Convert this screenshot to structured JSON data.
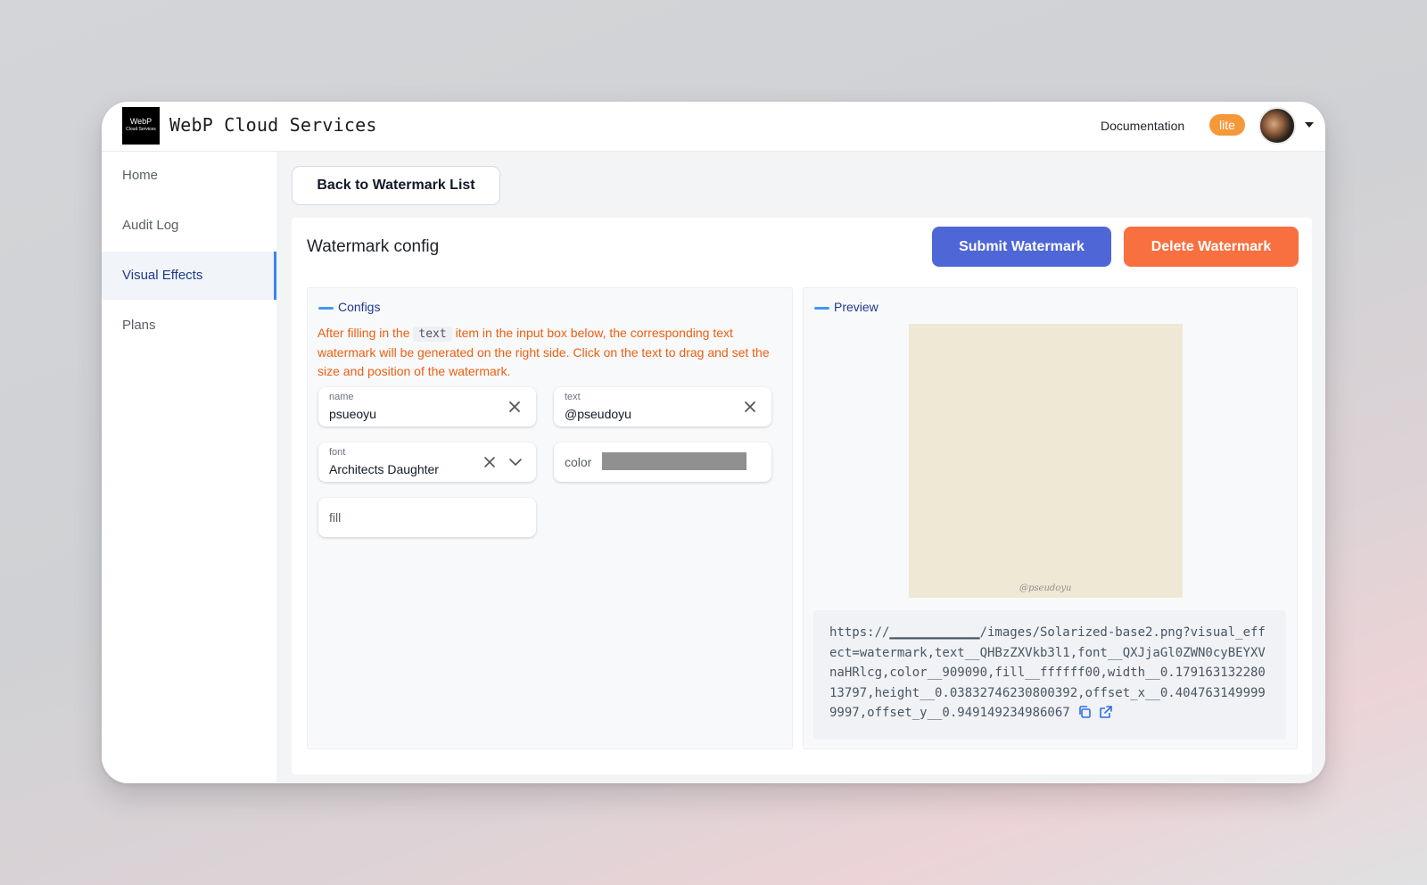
{
  "header": {
    "logo_line1": "WebP",
    "logo_line2": "Cloud Services",
    "title": "WebP Cloud Services",
    "documentation_label": "Documentation",
    "plan_badge": "lite"
  },
  "sidebar": {
    "items": [
      {
        "label": "Home"
      },
      {
        "label": "Audit Log"
      },
      {
        "label": "Visual Effects",
        "active": true
      },
      {
        "label": "Plans"
      }
    ]
  },
  "main": {
    "back_button_label": "Back to Watermark List",
    "card_title": "Watermark config",
    "submit_label": "Submit Watermark",
    "delete_label": "Delete Watermark"
  },
  "configs": {
    "section_label": "Configs",
    "hint_before": "After filling in the ",
    "hint_code": "text",
    "hint_after": " item in the input box below, the corresponding text watermark will be generated on the right side. Click on the text to drag and set the size and position of the watermark.",
    "name_label": "name",
    "name_value": "psueoyu",
    "text_label": "text",
    "text_value": "@pseudoyu",
    "font_label": "font",
    "font_value": "Architects Daughter",
    "color_label": "color",
    "color_value": "#909090",
    "fill_placeholder": "fill"
  },
  "preview": {
    "section_label": "Preview",
    "background_color": "#eee8d5",
    "watermark_text": "@pseudoyu",
    "url": "https://▁▁▁▁▁▁▁▁▁▁▁▁/images/Solarized-base2.png?visual_effect=watermark,text__QHBzZXVkb3l1,font__QXJjaGl0ZWN0cyBEYXVnaHRlcg,color__909090,fill__ffffff00,width__0.17916313228013797,height__0.03832746230800392,offset_x__0.4047631499999997,offset_y__0.949149234986067"
  },
  "colors": {
    "primary": "#4f67d6",
    "danger": "#f8703f",
    "badge": "#f59839",
    "hint": "#ec5f0f",
    "active_nav": "#3b82f6"
  }
}
